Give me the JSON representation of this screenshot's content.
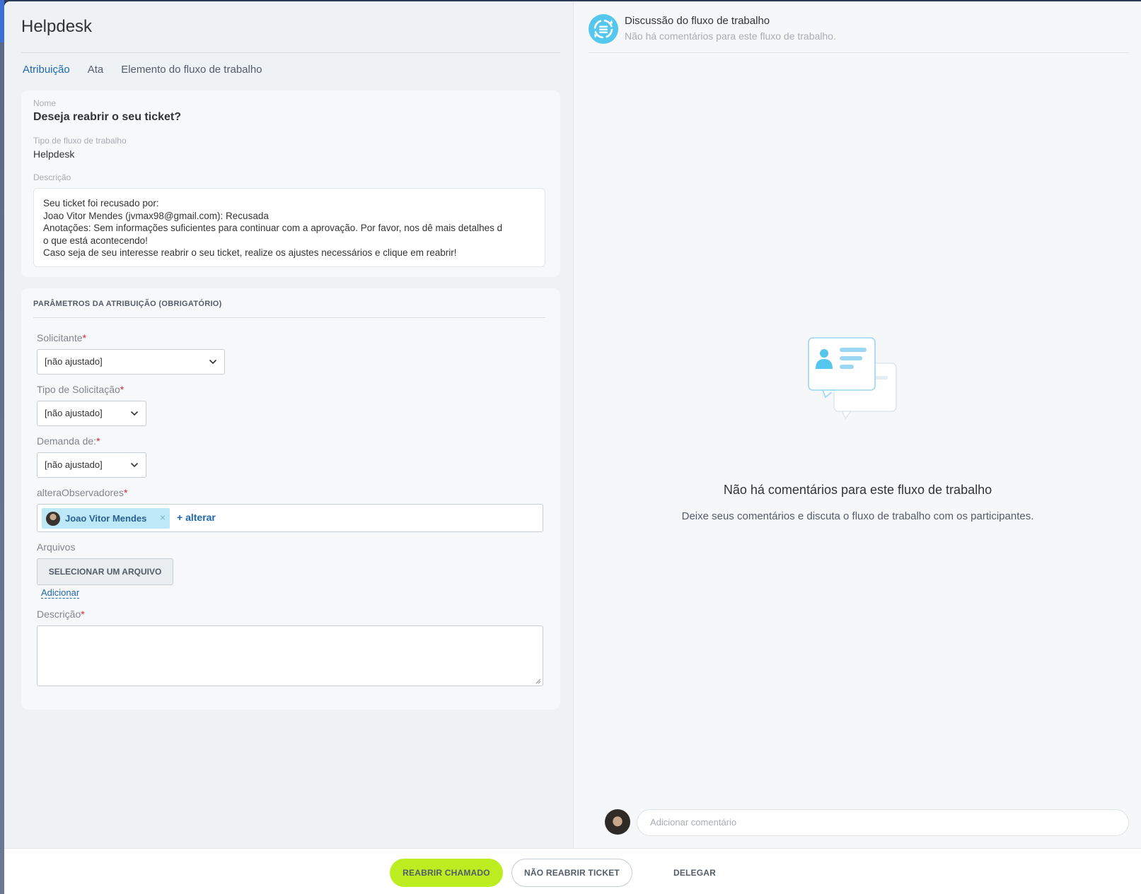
{
  "app": {
    "title": "Helpdesk",
    "tabs": [
      {
        "label": "Atribuição",
        "active": true
      },
      {
        "label": "Ata",
        "active": false
      },
      {
        "label": "Elemento do fluxo de trabalho",
        "active": false
      }
    ]
  },
  "details": {
    "name_label": "Nome",
    "name_value": "Deseja reabrir o seu ticket?",
    "type_label": "Tipo de fluxo de trabalho",
    "type_value": "Helpdesk",
    "desc_label": "Descrição",
    "desc_lines": [
      "Seu ticket foi recusado por:",
      "Joao Vitor Mendes (jvmax98@gmail.com): Recusada",
      "Anotações: Sem informações suficientes para continuar com a aprovação. Por favor, nos dê mais detalhes d",
      "o que está acontecendo!",
      "Caso seja de seu interesse reabrir o seu ticket, realize os ajustes necessários e clique em reabrir!"
    ]
  },
  "params": {
    "section_title": "PARÂMETROS DA ATRIBUIÇÃO (OBRIGATÓRIO)",
    "required_mark": "*",
    "solicitante": {
      "label": "Solicitante",
      "value": "[não ajustado]"
    },
    "tipo_solicitacao": {
      "label": "Tipo de Solicitação",
      "value": "[não ajustado]"
    },
    "demanda": {
      "label": "Demanda de:",
      "value": "[não ajustado]"
    },
    "observadores": {
      "label": "alteraObservadores",
      "tag_name": "Joao Vitor Mendes",
      "tag_remove": "×",
      "add_label": "+ alterar"
    },
    "arquivos": {
      "label": "Arquivos",
      "button": "SELECIONAR UM ARQUIVO",
      "add_link": "Adicionar"
    },
    "descricao": {
      "label": "Descrição",
      "value": ""
    }
  },
  "discussion": {
    "title": "Discussão do fluxo de trabalho",
    "subtitle": "Não há comentários para este fluxo de trabalho.",
    "empty_title": "Não há comentários para este fluxo de trabalho",
    "empty_subtitle": "Deixe seus comentários e discuta o fluxo de trabalho com os participantes.",
    "comment_placeholder": "Adicionar comentário"
  },
  "actions": {
    "primary": "REABRIR CHAMADO",
    "secondary": "NÃO REABRIR TICKET",
    "link": "DELEGAR"
  },
  "colors": {
    "accent": "#2067b0",
    "primary_button": "#bbed21",
    "discussion_icon": "#55c6ee",
    "required": "#e0262a"
  },
  "icons": [
    "chevron-down-icon",
    "discussion-workflow-icon",
    "chat-empty-illustration",
    "avatar",
    "remove-icon",
    "resize-grip-icon"
  ]
}
